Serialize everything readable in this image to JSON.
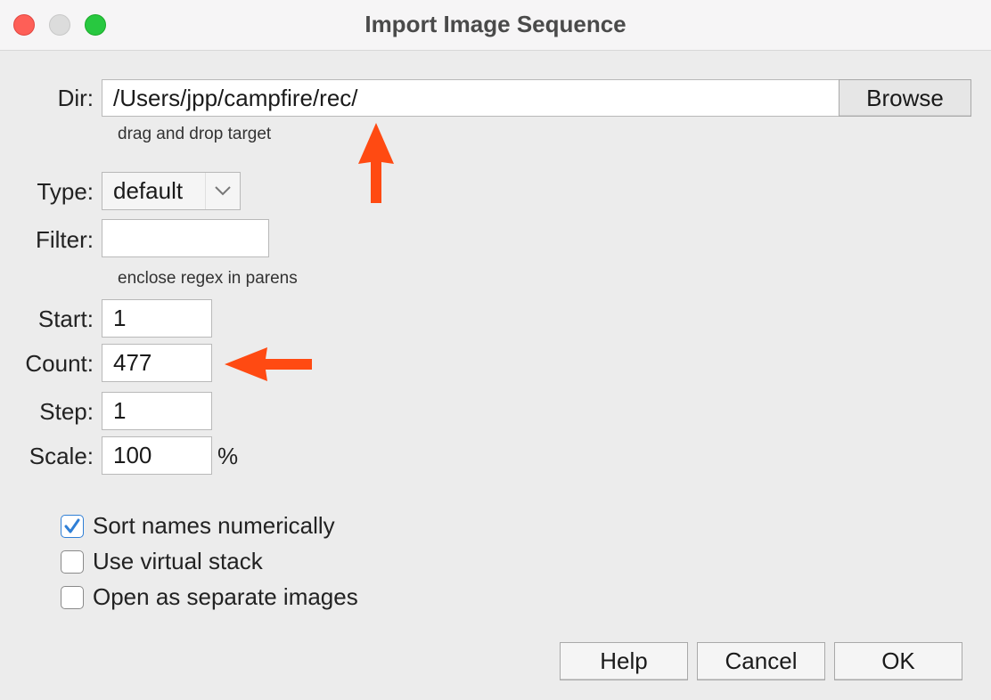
{
  "window": {
    "title": "Import Image Sequence"
  },
  "dir": {
    "label": "Dir:",
    "value": "/Users/jpp/campfire/rec/",
    "browse_label": "Browse",
    "hint": "drag and drop target"
  },
  "type": {
    "label": "Type:",
    "selected": "default"
  },
  "filter": {
    "label": "Filter:",
    "value": "",
    "hint": "enclose regex in parens"
  },
  "start": {
    "label": "Start:",
    "value": "1"
  },
  "count": {
    "label": "Count:",
    "value": "477"
  },
  "step": {
    "label": "Step:",
    "value": "1"
  },
  "scale": {
    "label": "Scale:",
    "value": "100",
    "unit": "%"
  },
  "options": [
    {
      "label": "Sort names numerically",
      "checked": true
    },
    {
      "label": "Use virtual stack",
      "checked": false
    },
    {
      "label": "Open as separate images",
      "checked": false
    }
  ],
  "buttons": {
    "help": "Help",
    "cancel": "Cancel",
    "ok": "OK"
  },
  "colors": {
    "annotation_arrow": "#ff4a12",
    "checkbox_accent": "#2f7fd6"
  },
  "icons": {
    "type_dropdown": "chevron-down-icon",
    "checked": "checkmark-icon"
  }
}
